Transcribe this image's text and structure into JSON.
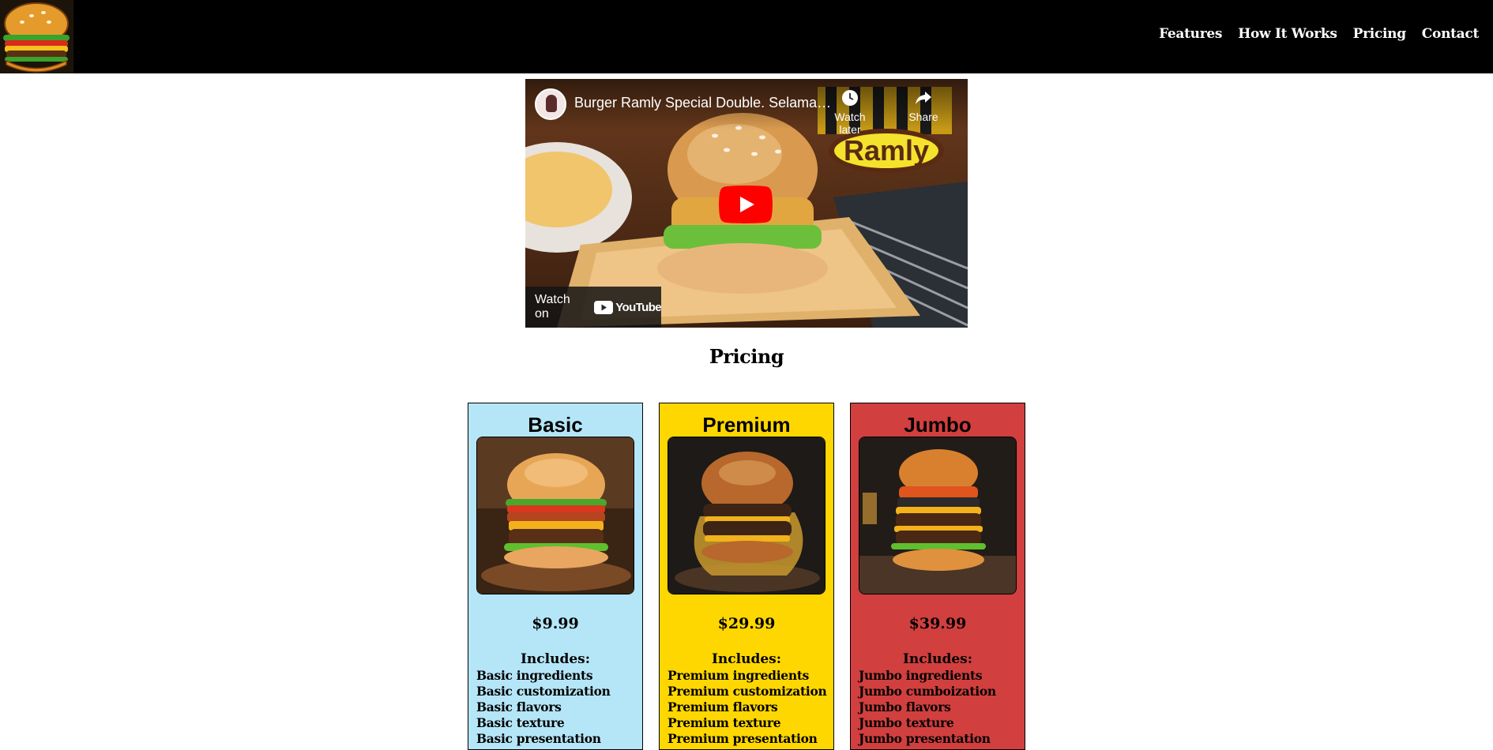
{
  "header": {
    "logo_alt": "burger logo",
    "nav": [
      {
        "label": "Features"
      },
      {
        "label": "How It Works"
      },
      {
        "label": "Pricing"
      },
      {
        "label": "Contact"
      }
    ]
  },
  "video": {
    "title": "Burger Ramly Special Double. Selamat Mencuba!",
    "watch_later": "Watch later",
    "share": "Share",
    "watch_on": "Watch on",
    "youtube": "YouTube",
    "brand_text": "Ramly"
  },
  "pricing": {
    "title": "Pricing",
    "plans": [
      {
        "name": "Basic",
        "price": "$9.99",
        "includes_label": "Includes:",
        "color": "#b4e6f8",
        "features": [
          "Basic ingredients",
          "Basic customization",
          "Basic flavors",
          "Basic texture",
          "Basic presentation"
        ]
      },
      {
        "name": "Premium",
        "price": "$29.99",
        "includes_label": "Includes:",
        "color": "#ffd700",
        "features": [
          "Premium ingredients",
          "Premium customization",
          "Premium flavors",
          "Premium texture",
          "Premium presentation"
        ]
      },
      {
        "name": "Jumbo",
        "price": "$39.99",
        "includes_label": "Includes:",
        "color": "#d13f3f",
        "features": [
          "Jumbo ingredients",
          "Jumbo cumboization",
          "Jumbo flavors",
          "Jumbo texture",
          "Jumbo presentation"
        ]
      }
    ]
  },
  "colors": {
    "header_bg": "#000000",
    "youtube_red": "#ff0000"
  }
}
